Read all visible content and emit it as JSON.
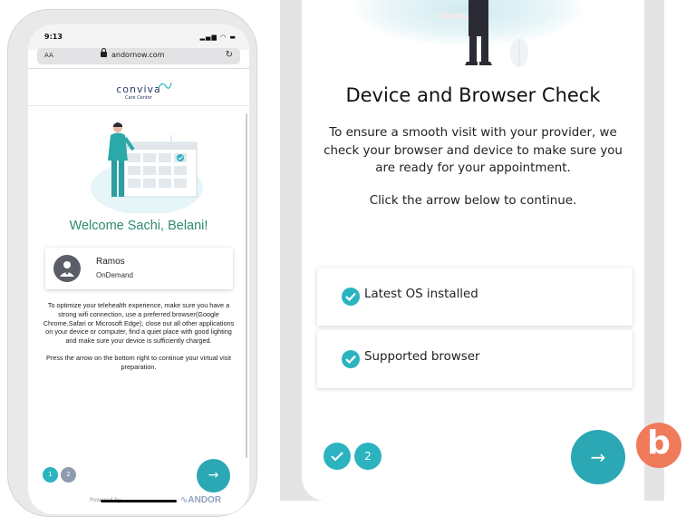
{
  "left_phone": {
    "status_time": "9:13",
    "url_aa": "AA",
    "url": "andornow.com",
    "logo_main": "conviva",
    "logo_sub": "Care Center",
    "welcome": "Welcome Sachi, Belani!",
    "provider": {
      "name": "Ramos",
      "type": "OnDemand"
    },
    "info_p1": "To optimize your telehealth experience, make sure you have a strong wifi connection, use a preferred browser(Google Chrome,Safari or Microsoft Edge), close out all other applications on your device or computer, find a quiet place with good lighting and make sure your device is sufficiently charged.",
    "info_p2": "Press the arrow on the bottom right to continue your virtual visit preparation.",
    "steps": [
      "1",
      "2"
    ],
    "next_arrow": "→",
    "powered_by": "Powered by",
    "brand": "ANDOR"
  },
  "right_phone": {
    "title": "Device and Browser Check",
    "body": "To ensure a smooth visit with your provider, we check your browser and device to make sure you are ready for your appointment.",
    "instruction": "Click the arrow below to continue.",
    "checks": [
      {
        "label": "Latest OS installed",
        "status": "done"
      },
      {
        "label": "Supported browser",
        "status": "done"
      }
    ],
    "step2": "2",
    "next_arrow": "→"
  },
  "annotation_badge": "b",
  "colors": {
    "teal": "#2bb3c0",
    "welcome_green": "#2e8b73",
    "badge": "#f07b5a"
  }
}
